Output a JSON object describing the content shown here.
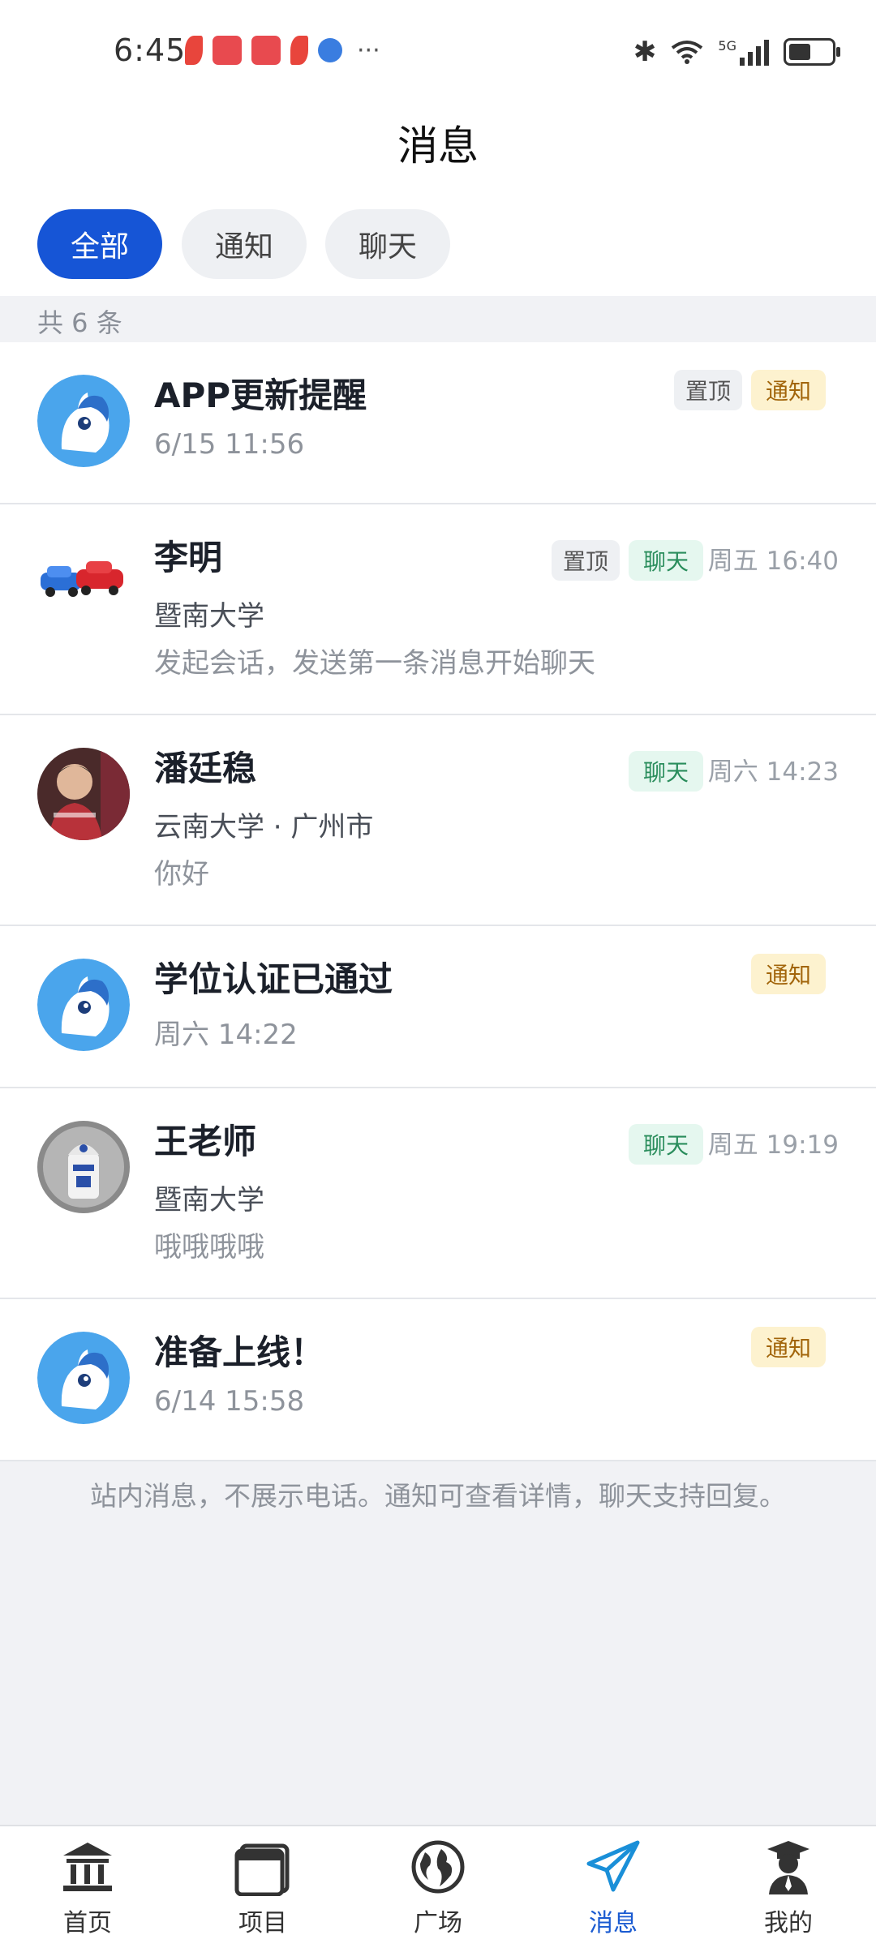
{
  "status_bar": {
    "time": "6:45",
    "network": "5G"
  },
  "header": {
    "title": "消息"
  },
  "filters": [
    {
      "label": "全部",
      "active": true
    },
    {
      "label": "通知",
      "active": false
    },
    {
      "label": "聊天",
      "active": false
    }
  ],
  "count_text": "共 6 条",
  "messages": [
    {
      "title": "APP更新提醒",
      "meta": "6/15 11:56",
      "badges": [
        "置顶",
        "通知"
      ],
      "avatar": "pony-icon"
    },
    {
      "title": "李明",
      "sub": "暨南大学",
      "preview": "发起会话，发送第一条消息开始聊天",
      "time": "周五 16:40",
      "badges": [
        "置顶",
        "聊天"
      ],
      "avatar": "toy-cars-photo"
    },
    {
      "title": "潘廷稳",
      "sub": "云南大学 · 广州市",
      "preview": "你好",
      "time": "周六 14:23",
      "badges": [
        "聊天"
      ],
      "avatar": "person-photo"
    },
    {
      "title": "学位认证已通过",
      "meta": "周六 14:22",
      "badges": [
        "通知"
      ],
      "avatar": "pony-icon"
    },
    {
      "title": "王老师",
      "sub": "暨南大学",
      "preview": "哦哦哦哦",
      "time": "周五 19:19",
      "badges": [
        "聊天"
      ],
      "avatar": "robot-photo"
    },
    {
      "title": "准备上线！",
      "meta": "6/14 15:58",
      "badges": [
        "通知"
      ],
      "avatar": "pony-icon"
    }
  ],
  "footnote": "站内消息，不展示电话。通知可查看详情，聊天支持回复。",
  "nav": [
    {
      "label": "首页",
      "icon": "bank-icon"
    },
    {
      "label": "项目",
      "icon": "folder-icon"
    },
    {
      "label": "广场",
      "icon": "globe-icon"
    },
    {
      "label": "消息",
      "icon": "paper-plane-icon",
      "active": true
    },
    {
      "label": "我的",
      "icon": "graduate-icon"
    }
  ],
  "colors": {
    "accent": "#1655d6",
    "notice_bg": "#fdf2cf",
    "chat_bg": "#e5f7ef",
    "pin_bg": "#eef0f3"
  }
}
